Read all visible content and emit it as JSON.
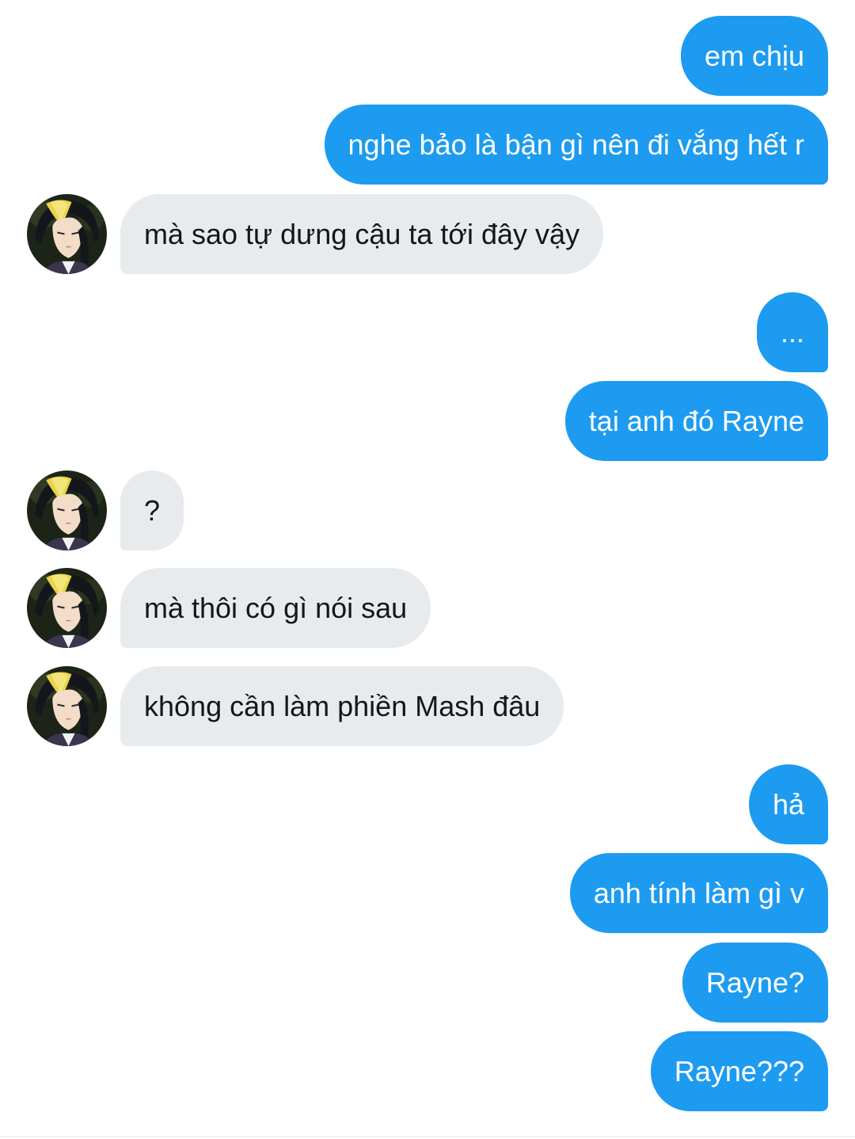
{
  "colors": {
    "outgoing_bubble": "#1d9bf0",
    "outgoing_text": "#ffffff",
    "incoming_bubble": "#e7ebee",
    "incoming_text": "#14171a",
    "background": "#ffffff"
  },
  "avatar": {
    "icon": "profile-avatar-anime-character"
  },
  "messages": [
    {
      "direction": "out",
      "text": "em chịu"
    },
    {
      "direction": "out",
      "text": "nghe bảo là bận gì nên đi vắng hết r"
    },
    {
      "direction": "in",
      "text": "mà sao tự dưng cậu ta tới đây vậy"
    },
    {
      "direction": "out",
      "text": "..."
    },
    {
      "direction": "out",
      "text": "tại anh đó Rayne"
    },
    {
      "direction": "in",
      "text": "?"
    },
    {
      "direction": "in",
      "text": "mà thôi có gì nói sau"
    },
    {
      "direction": "in",
      "text": "không cần làm phiền Mash đâu"
    },
    {
      "direction": "out",
      "text": "hả"
    },
    {
      "direction": "out",
      "text": "anh tính làm gì v"
    },
    {
      "direction": "out",
      "text": "Rayne?"
    },
    {
      "direction": "out",
      "text": "Rayne???"
    }
  ]
}
